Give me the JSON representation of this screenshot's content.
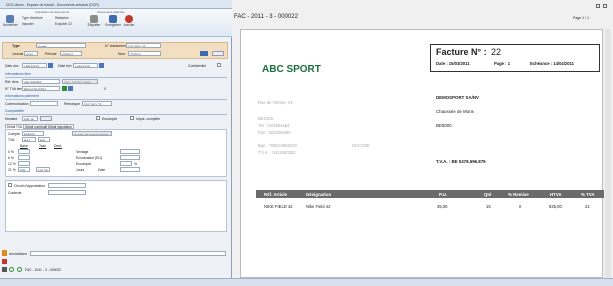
{
  "left_window": {
    "title": "DCG-demo - Espace de travail - Documents entrants (DCR)",
    "ribbon": {
      "groups": [
        "Acquisition de documents",
        "Documents attachés"
      ],
      "buttons": [
        "Numériser",
        "Type d'écriture",
        "Importer",
        "Rattacher",
        "Exploiter",
        "Étiqueter",
        "Enregistrer",
        "Annuler"
      ],
      "sub_items": [
        "Exploiter 22"
      ]
    },
    "form": {
      "type_label": "Type",
      "type_value": "Achat",
      "classement_label": "N° classement",
      "classement_value": "101.2011.22",
      "journal_label": "Journal",
      "journal_value": "ACH",
      "periode_label": "Période",
      "periode_value": "03/2011",
      "num_label": "Num",
      "num_value": "22/2011",
      "date_doc_label": "Date doc",
      "date_doc_value": "15/03/2011",
      "date_ech_label": "Date éch",
      "date_ech_value": "14/04/2011",
      "confidentiel_label": "Confidentiel",
      "tiers_header": "Informations tiers",
      "ref_tiers_label": "Réf. tiers",
      "ref_tiers_value": "ABCSPORT",
      "ref_tiers_name": "ABC SPORT SPRL",
      "tva_label": "N° TVA tiers",
      "tva_value": "BE0413040252",
      "tva_extra": "0",
      "paiement_header": "Informations paiement",
      "communication_label": "Communication",
      "remarque_label": "Remarque",
      "remarque_value": "101.2011.22",
      "compta_header": "Comptabilité",
      "montant_label": "Montant",
      "montant_value": "635,25",
      "escompte_label": "Escompte",
      "impute_label": "Imput. complète"
    },
    "tabs": [
      "Détail TVA",
      "Détail numéraire",
      "Détail imputation"
    ],
    "detail": {
      "compte_label": "Compte",
      "compte_value": "604000",
      "compte_name": "Achats de marchandises",
      "tva_label": "TVA",
      "tva_value": "NAT",
      "tva_code": "MD",
      "col_headers": [
        "Base",
        "Taxe",
        "Dest."
      ],
      "rate_rows": [
        "0 %",
        "6 %",
        "12 %",
        "21 %"
      ],
      "base_21": "525",
      "taxe_21": "110,25",
      "right_labels": [
        "Ventage",
        "Exonération (EU)",
        "Escompte",
        "Jours",
        "Date"
      ],
      "escompte_pct": "%"
    },
    "circuit_label": "Circuit d'approbation",
    "contexte_label": "Contexte",
    "annotations_label": "Annotations",
    "doc_name": "FAC - 2011 - 3 - 000022"
  },
  "viewer": {
    "title": "FAC - 2011 - 3 - 000022",
    "page_indicator": "Page 1 / 1",
    "invoice": {
      "company": "ABC SPORT",
      "invoice_title": "Facture N° :",
      "invoice_number": "22",
      "date_label": "Date : 15/03/2011",
      "page_label": "Page : 1",
      "echeance_label": "Echéance : 14/04/2011",
      "client_name": "DEMOSPORT SA/NV",
      "client_street": "Chaussée de Mons",
      "client_zip": "BE5000",
      "sender_address": "Rue de Tamise, 01",
      "sender_zip": "BE1000",
      "sender_tel": "Tél : 02/2564664",
      "sender_fax": "Fax : 02/2564666",
      "sender_bqe": "Bqe : 795234660423",
      "sender_bqe2": "GKCCBE",
      "sender_tva": "T.V.A. : 0413040252",
      "client_tva": "T.V.A. : BE 0478.696.879",
      "table_headers": [
        "Réf. Article",
        "Désignation",
        "P.U.",
        "Qté",
        "% Remise",
        "HTVA",
        "% TVA"
      ],
      "rows": [
        [
          "NIKE FIELD 42",
          "Nike Field 42",
          "35,00",
          "15",
          "0",
          "525,00",
          "21"
        ]
      ]
    }
  },
  "colors": {
    "accent": "#2c5aa0",
    "company_green": "#1a6e3c",
    "header_gray": "#6b6b6b"
  }
}
